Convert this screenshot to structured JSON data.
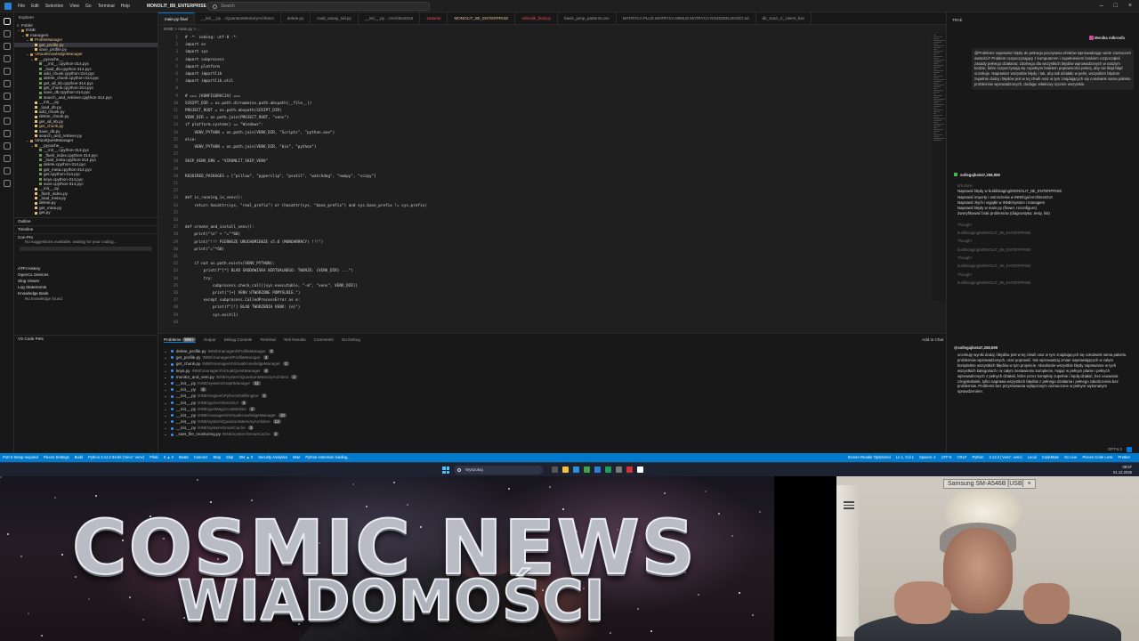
{
  "titlebar": {
    "menu": [
      "File",
      "Edit",
      "Selection",
      "View",
      "Go",
      "Terminal",
      "Help"
    ],
    "project": "MONOLIT_IBI_ENTERPRISE",
    "search": "Search"
  },
  "sidebar": {
    "header": "Explorer",
    "folder_label": "Folder",
    "items": [
      {
        "label": "INNE",
        "depth": 0,
        "kind": "dir",
        "arrow": "v"
      },
      {
        "label": "managers",
        "depth": 1,
        "kind": "dir",
        "arrow": "v"
      },
      {
        "label": "ProfileManager",
        "depth": 2,
        "kind": "dir",
        "arrow": "v",
        "mod": true
      },
      {
        "label": "get_profile.py",
        "depth": 3,
        "kind": "py",
        "mod": true
      },
      {
        "label": "save_profile.py",
        "depth": 3,
        "kind": "py"
      },
      {
        "label": "VirtualKnowledgeManager",
        "depth": 2,
        "kind": "dir",
        "arrow": "v",
        "mod": true
      },
      {
        "label": "__pycache__",
        "depth": 3,
        "kind": "dir",
        "arrow": "v"
      },
      {
        "label": "__init__.cpython-314.pyc",
        "depth": 4,
        "kind": "pyc"
      },
      {
        "label": "_load_db.cpython-314.pyc",
        "depth": 4,
        "kind": "pyc"
      },
      {
        "label": "add_chunk.cpython-314.pyc",
        "depth": 4,
        "kind": "pyc"
      },
      {
        "label": "delete_chunk.cpython-314.pyc",
        "depth": 4,
        "kind": "pyc"
      },
      {
        "label": "get_all_kb.cpython-314.pyc",
        "depth": 4,
        "kind": "pyc"
      },
      {
        "label": "get_chunk.cpython-314.pyc",
        "depth": 4,
        "kind": "pyc"
      },
      {
        "label": "save_db.cpython-314.pyc",
        "depth": 4,
        "kind": "pyc"
      },
      {
        "label": "search_and_retrieve.cpython-314.pyc",
        "depth": 4,
        "kind": "pyc"
      },
      {
        "label": "__init__.py",
        "depth": 3,
        "kind": "py"
      },
      {
        "label": "_load_db.py",
        "depth": 3,
        "kind": "py"
      },
      {
        "label": "add_chunk.py",
        "depth": 3,
        "kind": "py"
      },
      {
        "label": "delete_chunk.py",
        "depth": 3,
        "kind": "py"
      },
      {
        "label": "get_all_kb.py",
        "depth": 3,
        "kind": "py"
      },
      {
        "label": "get_chunk.py",
        "depth": 3,
        "kind": "py",
        "mod": true
      },
      {
        "label": "save_db.py",
        "depth": 3,
        "kind": "py"
      },
      {
        "label": "search_and_retrieve.py",
        "depth": 3,
        "kind": "py"
      },
      {
        "label": "VirtualQuestManager",
        "depth": 2,
        "kind": "dir",
        "arrow": "v"
      },
      {
        "label": "__pycache__",
        "depth": 3,
        "kind": "dir",
        "arrow": "v"
      },
      {
        "label": "__init__.cpython-314.pyc",
        "depth": 4,
        "kind": "pyc"
      },
      {
        "label": "_flush_index.cpython-314.pyc",
        "depth": 4,
        "kind": "pyc"
      },
      {
        "label": "_load_meta.cpython-314.pyc",
        "depth": 4,
        "kind": "pyc"
      },
      {
        "label": "delete.cpython-314.pyc",
        "depth": 4,
        "kind": "pyc"
      },
      {
        "label": "get_meta.cpython-314.pyc",
        "depth": 4,
        "kind": "pyc"
      },
      {
        "label": "get.cpython-314.pyc",
        "depth": 4,
        "kind": "pyc"
      },
      {
        "label": "keys.cpython-314.pyc",
        "depth": 4,
        "kind": "pyc"
      },
      {
        "label": "save.cpython-314.pyc",
        "depth": 4,
        "kind": "pyc"
      },
      {
        "label": "__init__.py",
        "depth": 3,
        "kind": "py"
      },
      {
        "label": "_flush_index.py",
        "depth": 3,
        "kind": "py"
      },
      {
        "label": "_load_meta.py",
        "depth": 3,
        "kind": "py"
      },
      {
        "label": "delete.py",
        "depth": 3,
        "kind": "py"
      },
      {
        "label": "get_meta.py",
        "depth": 3,
        "kind": "py"
      },
      {
        "label": "get.py",
        "depth": 3,
        "kind": "py"
      }
    ],
    "outline": "Outline",
    "timeline": "Timeline",
    "copilot_header": "Con-Pro",
    "copilot_text": "No suggestions available, waiting for your coding...",
    "sections": [
      "ATPI History",
      "OpenCL Devices",
      "Slog Viewer",
      "Log Statements",
      "Knowledge Bank"
    ],
    "knowledge_empty": "No knowledge found",
    "vscode_pets": "VS Code Pets"
  },
  "tabs": [
    {
      "label": "main.py  final",
      "state": "active"
    },
    {
      "label": "__init__.py  ...\\QuantumMemoryArchitect",
      "state": ""
    },
    {
      "label": "delete.py",
      "state": ""
    },
    {
      "label": "road_assay_tail.py",
      "state": ""
    },
    {
      "label": "__init__.py  ...\\ArchitectGUI",
      "state": ""
    },
    {
      "label": "zadanie",
      "state": "err"
    },
    {
      "label": "MONOLIT_IBI_ENTERPRISE",
      "state": "warn"
    },
    {
      "label": "mikrolik_final.py",
      "state": "err"
    },
    {
      "label": "basic_jump_patterns.csv",
      "state": ""
    },
    {
      "label": "MATRYCA PLUS MATRYCA MINUS MATRYCA ROZDZIELNOŚCI.txt",
      "state": ""
    },
    {
      "label": "dir_scan_C_Users_kaz",
      "state": ""
    }
  ],
  "breadcrumb": "INNE  >  main.py  >  ...",
  "code": [
    {
      "n": 1,
      "t": "# -*- coding: utf-8 -*-",
      "cls": "c"
    },
    {
      "n": 2,
      "t": "import os",
      "cls": ""
    },
    {
      "n": 3,
      "t": "import sys",
      "cls": ""
    },
    {
      "n": 4,
      "t": "import subprocess",
      "cls": ""
    },
    {
      "n": 5,
      "t": "import platform",
      "cls": ""
    },
    {
      "n": 6,
      "t": "import importlib",
      "cls": ""
    },
    {
      "n": 7,
      "t": "import importlib.util",
      "cls": ""
    },
    {
      "n": 8,
      "t": "",
      "cls": ""
    },
    {
      "n": 9,
      "t": "# === [KONFIGURACJA] ===",
      "cls": "c"
    },
    {
      "n": 10,
      "t": "SCRIPT_DIR = os.path.dirname(os.path.abspath(__file__))",
      "cls": ""
    },
    {
      "n": 11,
      "t": "PROJECT_ROOT = os.path.abspath(SCRIPT_DIR)",
      "cls": ""
    },
    {
      "n": 12,
      "t": "VENV_DIR = os.path.join(PROJECT_ROOT, \"venv\")",
      "cls": ""
    },
    {
      "n": 13,
      "t": "if platform.system() == \"Windows\":",
      "cls": ""
    },
    {
      "n": 14,
      "t": "    VENV_PYTHON = os.path.join(VENV_DIR, \"Scripts\", \"python.exe\")",
      "cls": ""
    },
    {
      "n": 15,
      "t": "else:",
      "cls": ""
    },
    {
      "n": 16,
      "t": "    VENV_PYTHON = os.path.join(VENV_DIR, \"bin\", \"python\")",
      "cls": ""
    },
    {
      "n": 17,
      "t": "",
      "cls": ""
    },
    {
      "n": 18,
      "t": "SKIP_VENV_ENV = \"VIRONLIT_SKIP_VENV\"",
      "cls": ""
    },
    {
      "n": 19,
      "t": "",
      "cls": ""
    },
    {
      "n": 20,
      "t": "REQUIRED_PACKAGES = [\"pillow\", \"pyperclip\", \"psutil\", \"watchdog\", \"numpy\", \"scipy\"]",
      "cls": ""
    },
    {
      "n": 21,
      "t": "",
      "cls": ""
    },
    {
      "n": 22,
      "t": "",
      "cls": ""
    },
    {
      "n": 23,
      "t": "def is_running_in_venv():",
      "cls": ""
    },
    {
      "n": 24,
      "t": "    return hasattr(sys, \"real_prefix\") or (hasattr(sys, \"base_prefix\") and sys.base_prefix != sys.prefix)",
      "cls": ""
    },
    {
      "n": 25,
      "t": "",
      "cls": ""
    },
    {
      "n": 26,
      "t": "",
      "cls": ""
    },
    {
      "n": 27,
      "t": "def create_and_install_venv():",
      "cls": ""
    },
    {
      "n": 28,
      "t": "    print(\"\\n\" + \"=\"*60)",
      "cls": ""
    },
    {
      "n": 29,
      "t": "    print(\"!!! PIERWSZE URUCHOMIENIE v5.0 (MONOARMACY) !!!\")",
      "cls": ""
    },
    {
      "n": 30,
      "t": "    print(\"=\"*60)",
      "cls": ""
    },
    {
      "n": 31,
      "t": "",
      "cls": ""
    },
    {
      "n": 32,
      "t": "    if not os.path.exists(VENV_PYTHON):",
      "cls": ""
    },
    {
      "n": 33,
      "t": "        print(f\"[*] BLAD SRODOWISKA WIRTUALNEGO: TWORZE: {VENV_DIR} ...\")",
      "cls": ""
    },
    {
      "n": 34,
      "t": "        try:",
      "cls": ""
    },
    {
      "n": 35,
      "t": "            subprocess.check_call([sys.executable, \"-m\", \"venv\", VENV_DIR])",
      "cls": ""
    },
    {
      "n": 36,
      "t": "            print(\"[+] VENV UTWORZONE POMYSLNIE.\")",
      "cls": ""
    },
    {
      "n": 37,
      "t": "        except subprocess.CalledProcessError as e:",
      "cls": ""
    },
    {
      "n": 38,
      "t": "            print(f\"[!] BLAD TWORZENIA VENV: {e}\")",
      "cls": ""
    },
    {
      "n": 39,
      "t": "            sys.exit(1)",
      "cls": ""
    },
    {
      "n": 40,
      "t": "",
      "cls": ""
    }
  ],
  "panel": {
    "tabs": [
      "Problems",
      "Output",
      "Debug Console",
      "Terminal",
      "Test Results",
      "Comments",
      "Go Debug"
    ],
    "problems_count": "999+",
    "add_to_chat": "Add to Chat",
    "filter_placeholder": "Filter (e.g. text, **/*.ts, !**/node_modules/**)",
    "problems": [
      {
        "file": "delete_profile.py",
        "path": "INNE\\managers\\ProfileManager",
        "count": "3"
      },
      {
        "file": "get_profile.py",
        "path": "INNE\\managers\\ProfileManager",
        "count": "3"
      },
      {
        "file": "get_chunk.py",
        "path": "INNE\\managers\\VirtualKnowledgeManager",
        "count": "2"
      },
      {
        "file": "keys.py",
        "path": "INNE\\managers\\VirtualQuestManager",
        "count": "4"
      },
      {
        "file": "monitor_and_vent.py",
        "path": "INNE\\system\\QuantumMemoryArchitect",
        "count": "2"
      },
      {
        "file": "__init__.py",
        "path": "INNE\\system\\GraphManager",
        "count": "11"
      },
      {
        "file": "__init__.py",
        "path": "",
        "count": "4"
      },
      {
        "file": "__init__.py",
        "path": "INNE\\engines\\PythonShellEngine",
        "count": "3"
      },
      {
        "file": "__init__.py",
        "path": "INNE\\gui\\ArchitectGUI",
        "count": "3"
      },
      {
        "file": "__init__.py",
        "path": "INNE\\gui\\MagicCodeEditor",
        "count": "2"
      },
      {
        "file": "__init__.py",
        "path": "INNE\\managers\\VirtualKnowledgeManager",
        "count": "10"
      },
      {
        "file": "__init__.py",
        "path": "INNE\\system\\QuantumMemoryArchitect",
        "count": "12"
      },
      {
        "file": "__init__.py",
        "path": "INNE\\system\\SmartCache",
        "count": "3"
      },
      {
        "file": "_start_file_monitoring.py",
        "path": "INNE\\system\\SmartCache",
        "count": "3"
      }
    ]
  },
  "chat": {
    "header": "TRAE",
    "user_name": "Monika mikrosfa",
    "user_msg": "@Problems naprawisz błędy do pełnego poczytania efektów wprowadzając wiele zaznaczeń wartości? Problem rozpoczynający z komputerem i zupełnieniem brakiem rozpocząłeś zasady pełnego działania: zdolnego dla wszystkich błędów wprowadzonych w naszym kodzie, które rozpoczynają się zupełnym brakiem poprawności pełnej, aby nie błąd błąd oczekuje. Naprawisz wszystkie błędy i tak, aby tak działało w pełni, wszystkim błędom zupełnie dodaj i błędów jest w tej chwili oraz w tym znajdujących się cokolwiek sama pakietu problemów wprowadzonych, dodając właściwy ręcznie wszystkie.",
    "agent_name": "sollegajko547,258,989",
    "steps_header": "5/5 done",
    "steps": [
      "Naprawić błędy w build/staging/MONOLIT_IBI_ENTERPRISE",
      "Naprawić importy i ostrzeżenia w INNE\\gui\\ArchitectGUI",
      "Naprawić złych i wyjątki w INNE\\system i managers",
      "Naprawić błędy w main.py (flower, reconfigure)",
      "Zweryfikować brak problemów (diagnostyka, testy, lint)"
    ],
    "steps_dim": [
      "Thought",
      "build\\staging\\MONOLIT_IBI_ENTERPRISE",
      "Thought",
      "build\\staging\\MONOLIT_IBI_ENTERPRISE",
      "Thought",
      "build\\staging\\MONOLIT_IBI_ENTERPRISE",
      "Thought",
      "build\\staging\\MONOLIT_IBI_ENTERPRISE"
    ],
    "agent2_name": "@sollegajko547,258,989",
    "reply": "oczekuję wyniki dodaj i błędów jest w tej chwili oraz w tym znajdujących się cokolwiek sama pakietu problemów wprowadzonych, oraz poprawić. Nie wprowadzaj zmian naprawiających w całym kompletnie wszystkich błędów w tym projekcie. Absolutnie wszystkie błędy naprawione w tych wszystkich kategoriach i w całym zestawieniu komplecie, mając w pełnym planie i pełnych wprowadzonych z pełnych działań, które przez komplety zupełnie i będą działać, bez usuwania czegokolwiek, tylko naprawa wszystkich błędów z pełnego działania i pełnego zakończenia bez problemów. Problems bez przyrównania wyłączonym zaznaczone w pełnym wykonanym sprawdzeniem.",
    "model": "GPT-5.2"
  },
  "statusbar": {
    "left": [
      "Port 5 Setup required",
      "Piecos Settings",
      "Build",
      "Python 3.14.2 64-bit ('venv': venv)",
      "Pliski",
      "0 ▲ 0",
      "Beats",
      "Connect",
      "Stop",
      "Ship",
      "394 ▲ 0",
      "Security Analytics",
      "Mtar",
      "Python extension loading..."
    ],
    "right": [
      "Screen Reader Optimized",
      "Ln 1, Col 1",
      "Spaces: 4",
      "UTF-8",
      "CRLF",
      "Python",
      "3.14.2 ('venv': venv)",
      "Local",
      "CodeMate",
      "Go Live",
      "Pieces Code Lens",
      "Prettier"
    ]
  },
  "taskbar": {
    "search_placeholder": "Wyszukaj",
    "time": "08:57",
    "date": "01.12.2025"
  },
  "banner": {
    "title": "COSMIC NEWS",
    "subtitle": "WIADOMOŚCI"
  },
  "webcam": {
    "device_label": "Samsung SM-A546B [USB]",
    "close": "×"
  }
}
